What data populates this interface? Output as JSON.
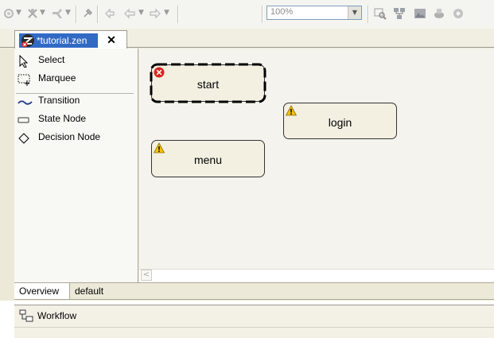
{
  "toolbar": {
    "zoom_value": "100%"
  },
  "editor_tab": {
    "label": "*tutorial.zen",
    "close": "✕"
  },
  "palette": {
    "items": [
      {
        "label": "Select",
        "icon": "pointer-icon"
      },
      {
        "label": "Marquee",
        "icon": "marquee-icon"
      },
      {
        "label": "Transition",
        "icon": "transition-icon"
      },
      {
        "label": "State Node",
        "icon": "state-node-icon"
      },
      {
        "label": "Decision Node",
        "icon": "decision-node-icon"
      }
    ]
  },
  "canvas": {
    "nodes": [
      {
        "label": "start",
        "status_icon": "error-icon",
        "selected": true
      },
      {
        "label": "login",
        "status_icon": "warning-icon",
        "selected": false
      },
      {
        "label": "menu",
        "status_icon": "warning-icon",
        "selected": false
      }
    ],
    "colors": {
      "node_fill": "#f3f0e2",
      "error": "#d9261c",
      "warning": "#f2c200"
    }
  },
  "bottom_tabs": {
    "overview": "Overview",
    "default": "default"
  },
  "outline": {
    "title": "Workflow"
  },
  "theme": {
    "selection": "#316ac5",
    "chrome": "#ece9d8"
  }
}
